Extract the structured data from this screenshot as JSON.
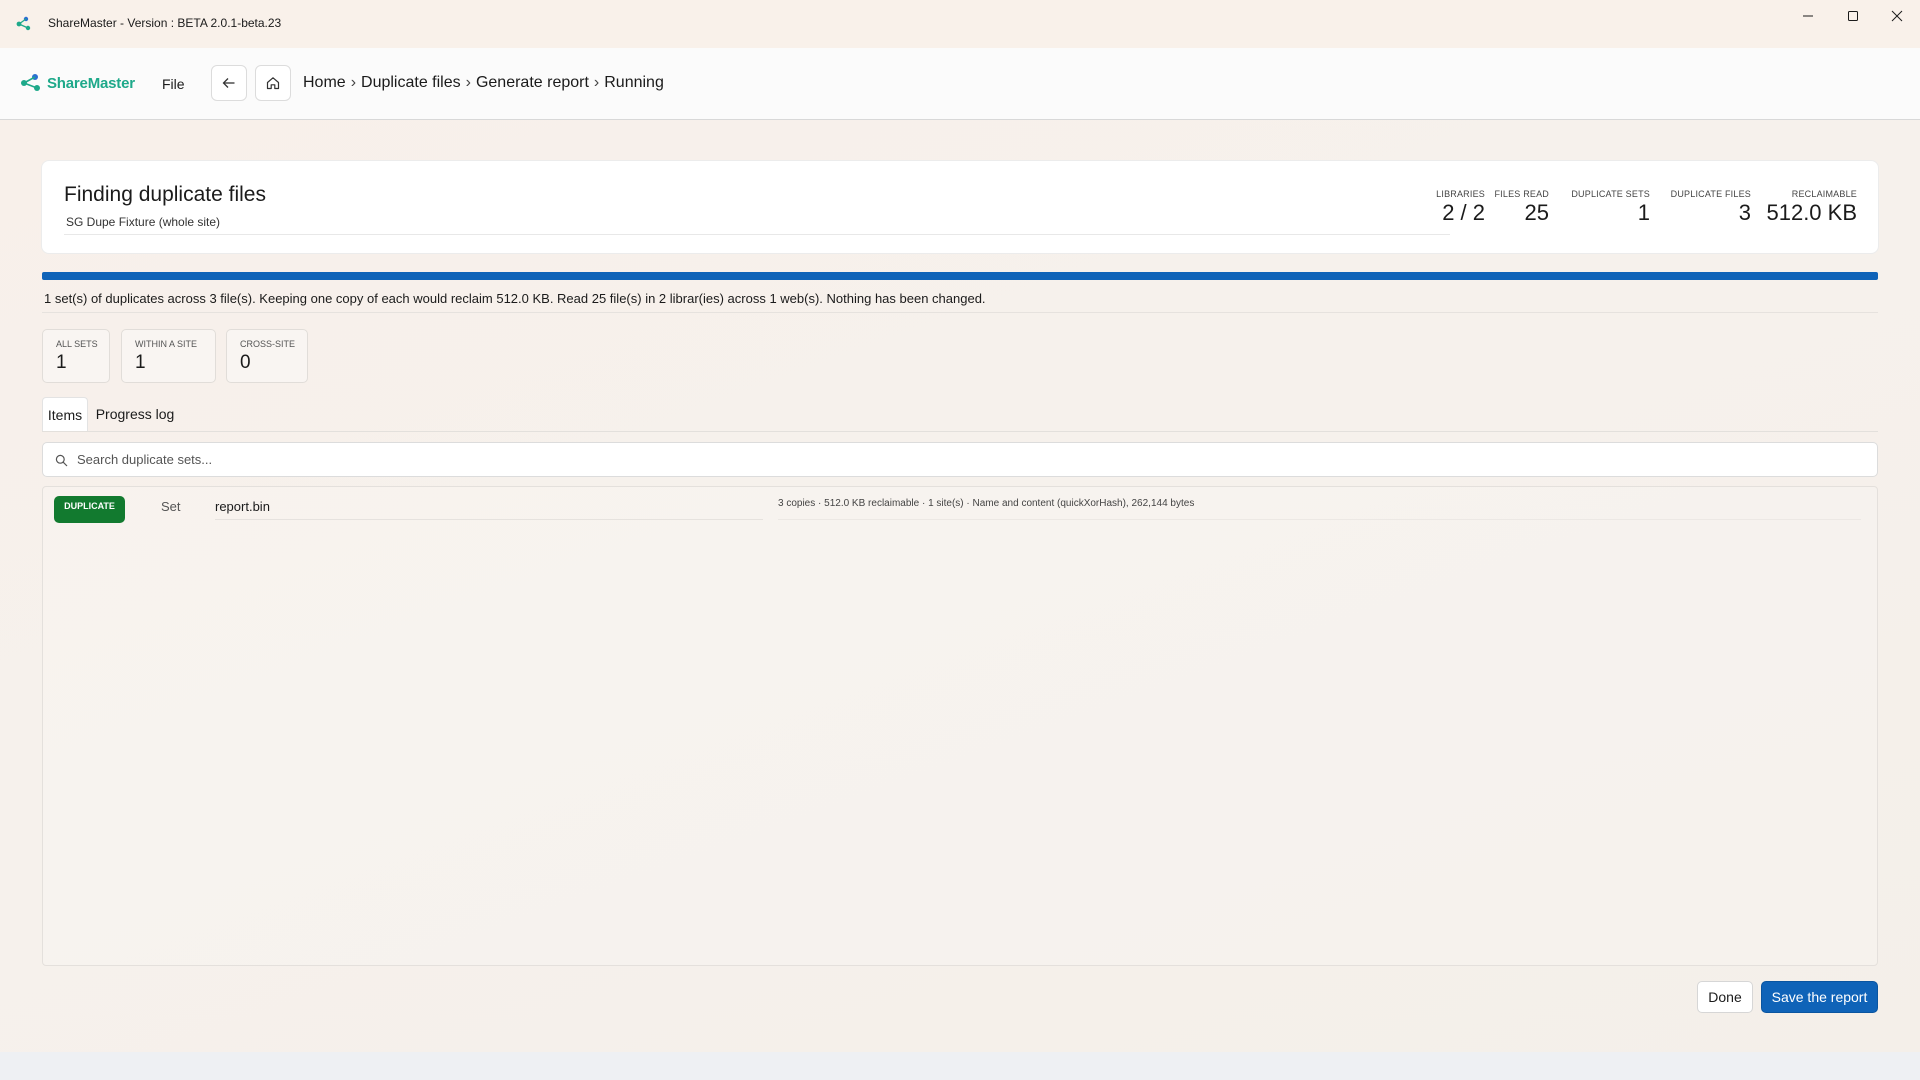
{
  "window": {
    "title": "ShareMaster - Version : BETA 2.0.1-beta.23"
  },
  "nav": {
    "brand": "ShareMaster",
    "file_menu": "File",
    "breadcrumb": [
      "Home",
      "Duplicate files",
      "Generate report",
      "Running"
    ],
    "separator": "›"
  },
  "header": {
    "title": "Finding duplicate files",
    "subtitle": "SG Dupe Fixture (whole site)",
    "stats": [
      {
        "label": "LIBRARIES",
        "value": "2 / 2"
      },
      {
        "label": "FILES READ",
        "value": "25"
      },
      {
        "label": "DUPLICATE SETS",
        "value": "1"
      },
      {
        "label": "DUPLICATE FILES",
        "value": "3"
      },
      {
        "label": "RECLAIMABLE",
        "value": "512.0 KB"
      }
    ]
  },
  "progress": {
    "fraction": 1.0,
    "summary": "1 set(s) of duplicates across 3 file(s). Keeping one copy of each would reclaim 512.0 KB. Read 25 file(s) in 2 librar(ies) across 1 web(s). Nothing has been changed."
  },
  "counters": [
    {
      "label": "ALL SETS",
      "value": "1"
    },
    {
      "label": "WITHIN A SITE",
      "value": "1"
    },
    {
      "label": "CROSS-SITE",
      "value": "0"
    }
  ],
  "tabs": [
    {
      "label": "Items",
      "active": true
    },
    {
      "label": "Progress log",
      "active": false
    }
  ],
  "search": {
    "placeholder": "Search duplicate sets...",
    "value": ""
  },
  "items": [
    {
      "badge": "DUPLICATE",
      "kind": "Set",
      "name": "report.bin",
      "detail": "3 copies · 512.0 KB reclaimable · 1 site(s) · Name and content (quickXorHash), 262,144 bytes"
    }
  ],
  "footer": {
    "done_label": "Done",
    "save_label": "Save the report"
  },
  "colors": {
    "accent": "#0f63b8",
    "brand": "#1ea98a",
    "duplicate_badge": "#127a2f"
  }
}
